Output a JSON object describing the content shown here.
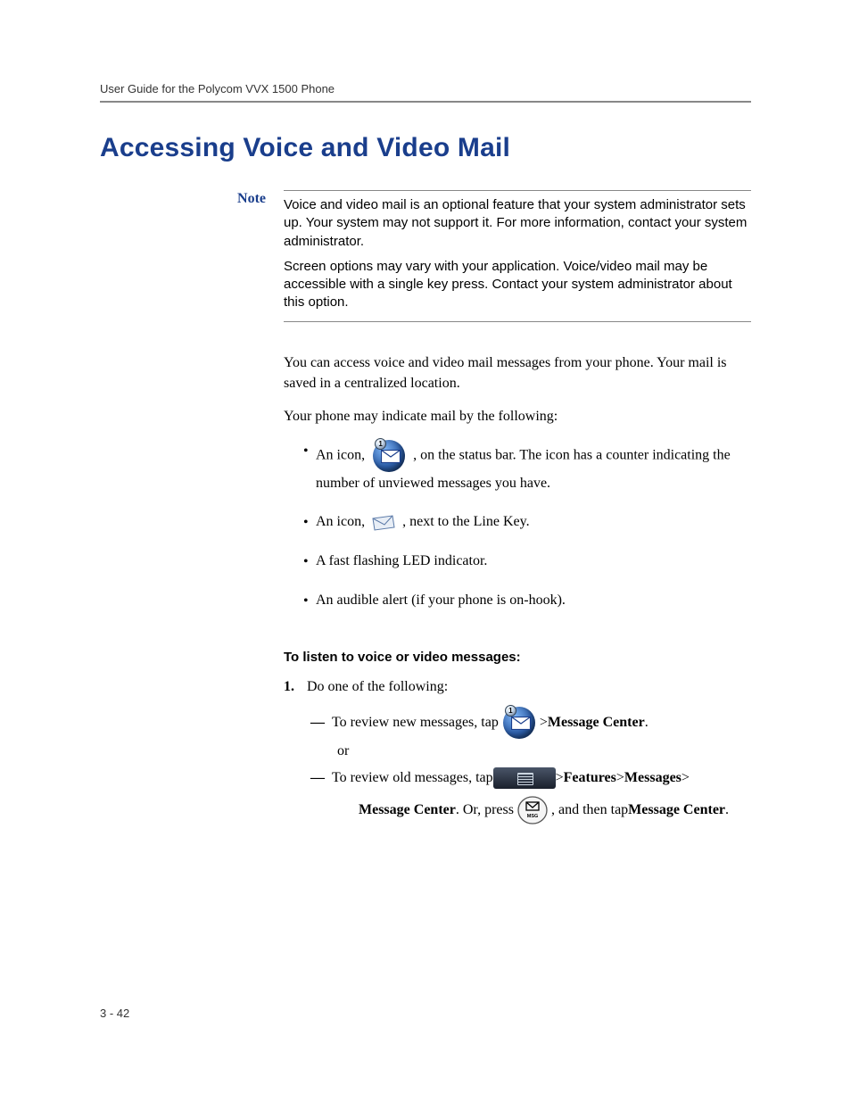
{
  "running_head": "User Guide for the Polycom VVX 1500 Phone",
  "title": "Accessing Voice and Video Mail",
  "note": {
    "label": "Note",
    "p1": "Voice and video mail is an optional feature that your system administrator sets up. Your system may not support it. For more information, contact your system administrator.",
    "p2": "Screen options may vary with your application. Voice/video mail may be accessible with a single key press. Contact your system administrator about this option."
  },
  "body": {
    "p1": "You can access voice and video mail messages from your phone. Your mail is saved in a centralized location.",
    "p2": "Your phone may indicate mail by the following:",
    "bullets": {
      "b1a": "An icon, ",
      "b1b": " , on the status bar. The icon has a counter indicating the number of unviewed messages you have.",
      "b2a": "An icon, ",
      "b2b": " , next to the Line Key.",
      "b3": "A fast flashing LED indicator.",
      "b4": "An audible alert (if your phone is on-hook)."
    },
    "subhead": "To listen to voice or video messages:",
    "step1_num": "1.",
    "step1_text": "Do one of the following:",
    "dash1a": "To review new messages, tap ",
    "dash1b": "  > ",
    "dash1c": "Message Center",
    "dash1d": ".",
    "or": "or",
    "dash2a": "To review old messages, tap ",
    "dash2b": "  > ",
    "dash2c": "Features",
    "dash2d": " > ",
    "dash2e": "Messages",
    "dash2f": " > ",
    "cont_a": "Message Center",
    "cont_b": ". Or, press ",
    "cont_c": " , and then tap ",
    "cont_d": "Message Center",
    "cont_e": "."
  },
  "badge_count": "1",
  "page_num": "3 - 42"
}
